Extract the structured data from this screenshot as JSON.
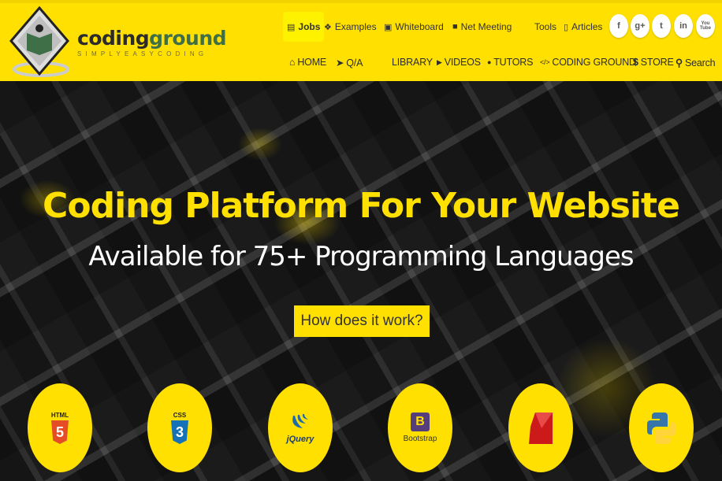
{
  "brand": {
    "name_part1": "coding",
    "name_part2": "ground",
    "tagline": "SIMPLYEASYCODING"
  },
  "top_links": [
    {
      "label": "Jobs",
      "icon": "briefcase-icon",
      "active": true
    },
    {
      "label": "Examples",
      "icon": "cubes-icon"
    },
    {
      "label": "Whiteboard",
      "icon": "whiteboard-icon"
    },
    {
      "label": "Net Meeting",
      "icon": "video-camera-icon"
    },
    {
      "label": "Tools"
    },
    {
      "label": "Articles",
      "icon": "document-icon"
    }
  ],
  "social": [
    {
      "label": "f",
      "icon": "facebook-icon"
    },
    {
      "label": "g+",
      "icon": "google-plus-icon"
    },
    {
      "label": "t",
      "icon": "twitter-icon"
    },
    {
      "label": "in",
      "icon": "linkedin-icon"
    },
    {
      "label": "You Tube",
      "icon": "youtube-icon"
    }
  ],
  "nav": [
    {
      "label": "HOME",
      "icon": "home-icon",
      "glyph": "⌂"
    },
    {
      "label": "Q/A",
      "icon": "paper-plane-icon",
      "glyph": "➤"
    },
    {
      "label": "LIBRARY"
    },
    {
      "label": "VIDEOS",
      "icon": "play-icon",
      "glyph": "▶"
    },
    {
      "label": "TUTORS",
      "icon": "user-icon",
      "glyph": "●"
    },
    {
      "label": "CODING GROUND",
      "icon": "code-icon",
      "glyph": "</>"
    },
    {
      "label": "STORE",
      "icon": "dollar-icon",
      "glyph": "$"
    },
    {
      "label": "Search",
      "icon": "search-icon",
      "glyph": "⚲"
    }
  ],
  "hero": {
    "title": "Coding Platform For Your Website",
    "subtitle": "Available for 75+ Programming Languages",
    "button": "How does it work?"
  },
  "technologies": [
    {
      "name": "HTML",
      "logo": "html5-icon",
      "text": "HTML",
      "glyph": "5",
      "color": "#e44d26"
    },
    {
      "name": "CSS",
      "logo": "css3-icon",
      "text": "CSS",
      "glyph": "3",
      "color": "#1572b6"
    },
    {
      "name": "jQuery",
      "logo": "jquery-icon",
      "text": "jQuery"
    },
    {
      "name": "Bootstrap",
      "logo": "bootstrap-icon",
      "text": "Bootstrap",
      "glyph": "B",
      "color": "#563d7c"
    },
    {
      "name": "Ruby",
      "logo": "ruby-icon",
      "color": "#cc1a1a"
    },
    {
      "name": "Python",
      "logo": "python-icon",
      "color": "#3776ab"
    }
  ],
  "colors": {
    "accent": "#ffe000",
    "text": "#333333"
  }
}
